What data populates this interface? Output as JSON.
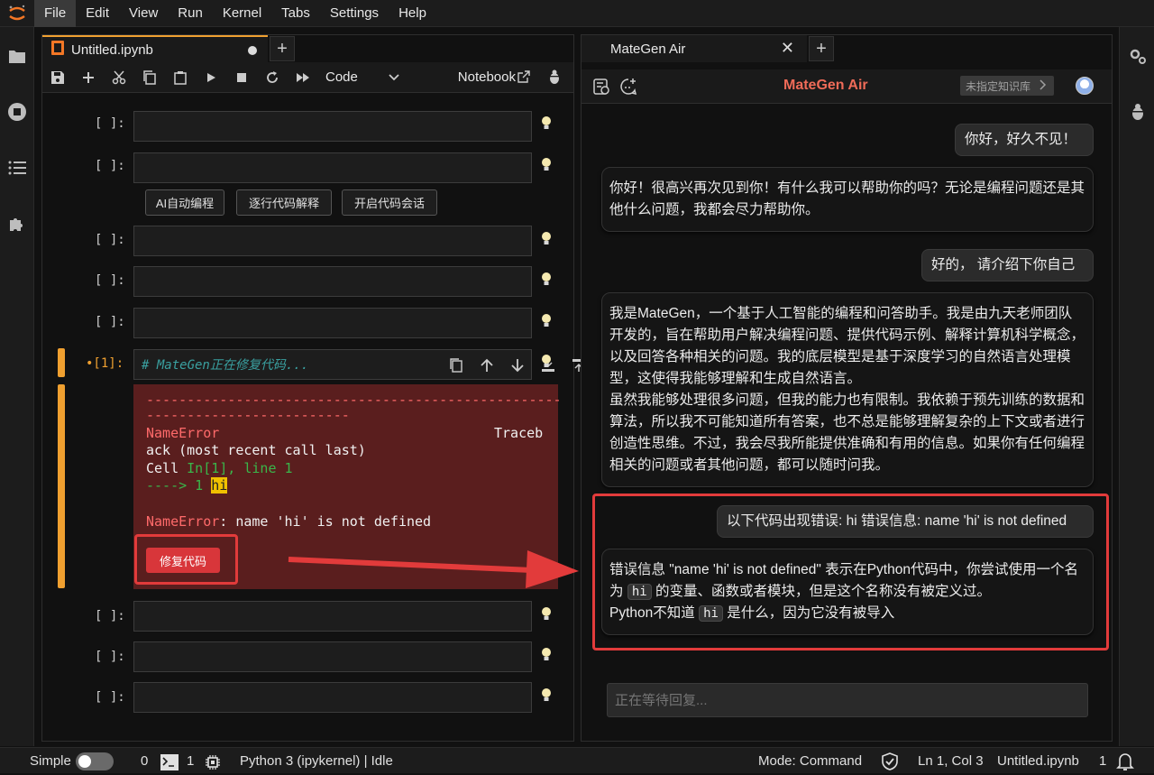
{
  "menubar": {
    "items": [
      "File",
      "Edit",
      "View",
      "Run",
      "Kernel",
      "Tabs",
      "Settings",
      "Help"
    ]
  },
  "notebook": {
    "tab_title": "Untitled.ipynb",
    "cell_type": "Code",
    "kernel_label": "Notebook",
    "empty_prompt": "[ ]:",
    "active_prompt": "•[1]:",
    "action_buttons": [
      "AI自动编程",
      "逐行代码解释",
      "开启代码会话"
    ],
    "active_cell_code": "# MateGen正在修复代码...",
    "error": {
      "dashes1": "---------------------------------------------------",
      "dashes2": "-------------------------",
      "name_error": "NameError",
      "traceback_tail": "Traceb",
      "line2": "ack (most recent call last)",
      "cell_label": "Cell ",
      "cell_ref": "In[1], line 1",
      "arrow": "----> 1 ",
      "hi": "hi",
      "final_name": "NameError",
      "final_msg": ": name 'hi' is not defined"
    },
    "fix_button": "修复代码"
  },
  "chat": {
    "tab_title": "MateGen Air",
    "brand": "MateGen Air",
    "kb_badge": "未指定知识库",
    "messages": [
      {
        "role": "user",
        "text": "你好，好久不见！"
      },
      {
        "role": "bot",
        "text": "你好！很高兴再次见到你！有什么我可以帮助你的吗？无论是编程问题还是其他什么问题，我都会尽力帮助你。"
      },
      {
        "role": "user",
        "text": "好的， 请介绍下你自己"
      },
      {
        "role": "bot",
        "text": "我是MateGen，一个基于人工智能的编程和问答助手。我是由九天老师团队开发的，旨在帮助用户解决编程问题、提供代码示例、解释计算机科学概念，以及回答各种相关的问题。我的底层模型是基于深度学习的自然语言处理模型，这使得我能够理解和生成自然语言。",
        "text2": "虽然我能够处理很多问题，但我的能力也有限制。我依赖于预先训练的数据和算法，所以我不可能知道所有答案，也不总是能够理解复杂的上下文或者进行创造性思维。不过，我会尽我所能提供准确和有用的信息。如果你有任何编程相关的问题或者其他问题，都可以随时问我。"
      },
      {
        "role": "user",
        "text": "以下代码出现错误: hi 错误信息: name 'hi' is not defined"
      },
      {
        "role": "bot",
        "parts": {
          "p1": "错误信息 \"name 'hi' is not defined\" 表示在Python代码中，你尝试使用一个名为 ",
          "code1": "hi",
          "p2": " 的变量、函数或者模块，但是这个名称没有被定义过。",
          "p3": "Python不知道 ",
          "code2": "hi",
          "p4": " 是什么，因为它没有被导入"
        }
      }
    ],
    "input_placeholder": "正在等待回复..."
  },
  "statusbar": {
    "mode_simple": "Simple",
    "terminals": "0",
    "kernels": "1",
    "kernel_status": "Python 3 (ipykernel) | Idle",
    "mode": "Mode: Command",
    "cursor": "Ln 1, Col 3",
    "filename": "Untitled.ipynb",
    "notifications": "1"
  },
  "colors": {
    "accent_orange": "#f0a030",
    "error_bg": "#5a1e1e",
    "highlight_red": "#e23b3b",
    "brand_red": "#ef6b58"
  },
  "icons": [
    "jupyter-logo-icon",
    "folder-icon",
    "stop-circle-icon",
    "list-icon",
    "puzzle-icon",
    "gear-icon",
    "bug-icon",
    "save-icon",
    "add-icon",
    "cut-icon",
    "copy-icon",
    "paste-icon",
    "run-icon",
    "stop-icon",
    "restart-icon",
    "fast-forward-icon",
    "lightbulb-icon",
    "shield-icon",
    "bell-icon"
  ]
}
